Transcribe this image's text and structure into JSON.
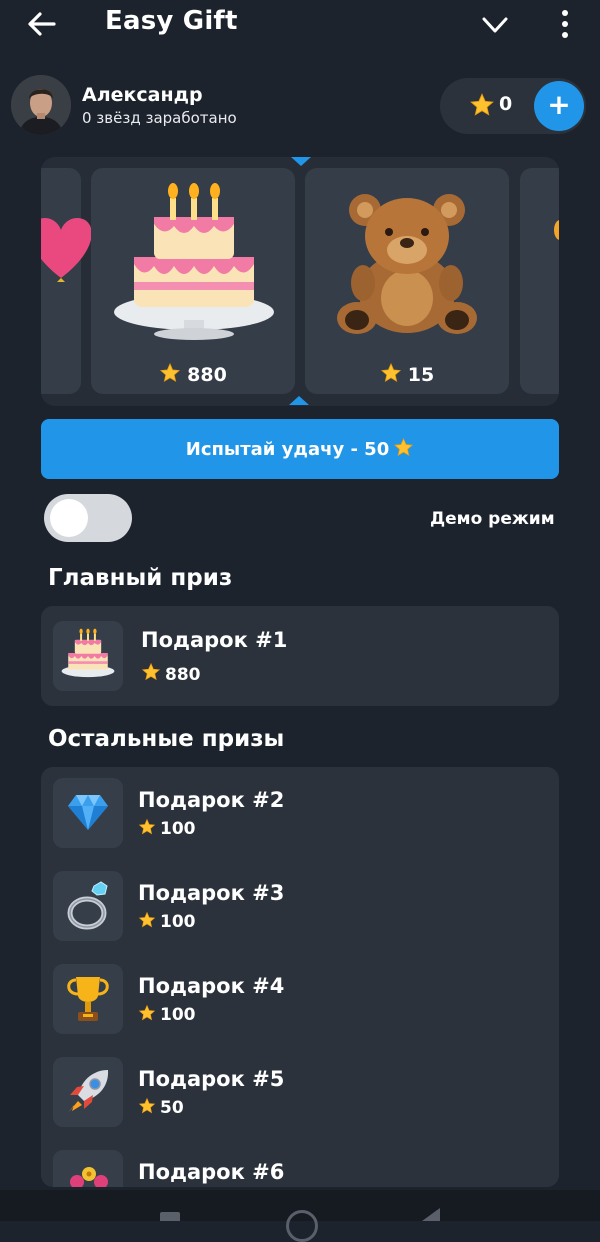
{
  "header": {
    "title": "Easy Gift"
  },
  "user": {
    "name": "Александр",
    "subtitle": "0 звёзд заработано"
  },
  "balance": {
    "value": "0"
  },
  "reel": {
    "items": [
      {
        "price": "880"
      },
      {
        "price": "15"
      }
    ]
  },
  "spin": {
    "label": "Испытай удачу - 50"
  },
  "demo": {
    "label": "Демо режим",
    "enabled": false
  },
  "main_prize": {
    "heading": "Главный приз",
    "name": "Подарок #1",
    "price": "880"
  },
  "other_prizes": {
    "heading": "Остальные призы",
    "items": [
      {
        "name": "Подарок #2",
        "price": "100",
        "icon": "diamond-icon"
      },
      {
        "name": "Подарок #3",
        "price": "100",
        "icon": "ring-icon"
      },
      {
        "name": "Подарок #4",
        "price": "100",
        "icon": "trophy-icon"
      },
      {
        "name": "Подарок #5",
        "price": "50",
        "icon": "rocket-icon"
      },
      {
        "name": "Подарок #6",
        "price": "",
        "icon": "flowers-icon"
      }
    ]
  },
  "colors": {
    "background": "#1d232d",
    "card": "#2b323c",
    "accent": "#2196e9",
    "star": "#ffc12e"
  }
}
